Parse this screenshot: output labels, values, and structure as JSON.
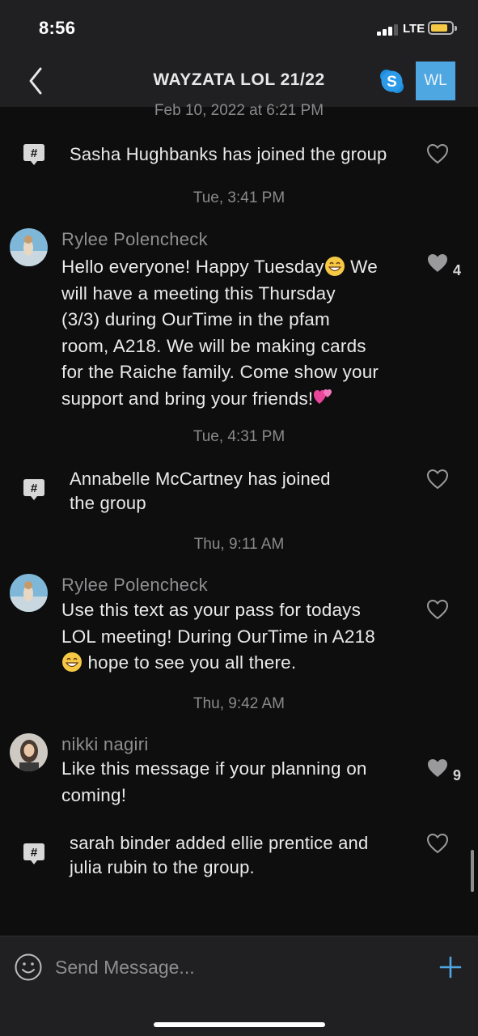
{
  "status_bar": {
    "time": "8:56",
    "network": "LTE"
  },
  "header": {
    "title": "WAYZATA LOL 21/22",
    "group_initials": "WL"
  },
  "messages": [
    {
      "type": "timestamp",
      "text": "Feb 10, 2022 at 6:21 PM"
    },
    {
      "type": "system",
      "text": "Sasha Hughbanks has joined the group",
      "likes": ""
    },
    {
      "type": "timestamp",
      "text": "Tue, 3:41 PM"
    },
    {
      "type": "user",
      "sender": "Rylee Polencheck",
      "lines": [
        "Hello everyone! Happy Tuesday",
        " We",
        "will have a meeting this Thursday",
        "(3/3) during OurTime in the pfam",
        "room, A218. We will be making cards",
        "for the Raiche family. Come show your",
        "support and bring your friends!"
      ],
      "likes": "4"
    },
    {
      "type": "timestamp",
      "text": "Tue, 4:31 PM"
    },
    {
      "type": "system",
      "lines": [
        "Annabelle McCartney has joined",
        "the group"
      ],
      "likes": ""
    },
    {
      "type": "timestamp",
      "text": "Thu, 9:11 AM"
    },
    {
      "type": "user",
      "sender": "Rylee Polencheck",
      "lines": [
        "Use this text as your pass for todays",
        "LOL meeting! During OurTime in A218",
        " hope to see you all there."
      ],
      "likes": ""
    },
    {
      "type": "timestamp",
      "text": "Thu, 9:42 AM"
    },
    {
      "type": "user",
      "sender": "nikki nagiri",
      "lines": [
        "Like this message if your planning on",
        "coming!"
      ],
      "likes": "9"
    },
    {
      "type": "system",
      "lines": [
        "sarah binder added ellie prentice and",
        "julia rubin to the group."
      ],
      "likes": ""
    }
  ],
  "composer": {
    "placeholder": "Send Message..."
  },
  "colors": {
    "accent": "#4fa7e2",
    "background": "#0e0e0f",
    "header": "#202022"
  }
}
